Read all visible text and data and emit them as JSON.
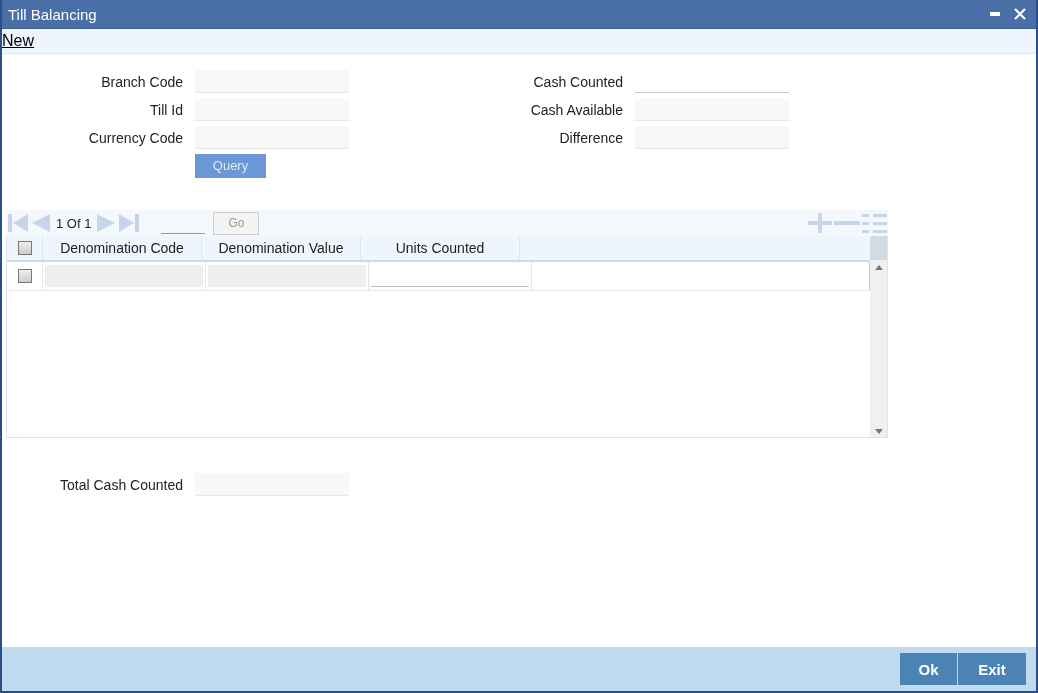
{
  "window": {
    "title": "Till Balancing"
  },
  "menu": [
    {
      "label": "New"
    }
  ],
  "left_fields": [
    {
      "label": "Branch Code",
      "editable": false
    },
    {
      "label": "Till Id",
      "editable": false
    },
    {
      "label": "Currency Code",
      "editable": false
    }
  ],
  "query_button": {
    "label": "Query",
    "disabled": true
  },
  "right_fields": [
    {
      "label": "Cash Counted",
      "editable": true
    },
    {
      "label": "Cash Available",
      "editable": false
    },
    {
      "label": "Difference",
      "editable": false
    }
  ],
  "grid": {
    "pager": {
      "text": "1 Of 1",
      "go": "Go",
      "go_disabled": true
    },
    "select_all_checked": false,
    "columns": [
      "Denomination Code",
      "Denomination Value",
      "Units Counted"
    ],
    "rows": [
      {
        "checked": false,
        "cells": [
          {
            "editable": false
          },
          {
            "editable": false
          },
          {
            "editable": true
          }
        ]
      }
    ]
  },
  "total": {
    "label": "Total Cash Counted",
    "editable": false
  },
  "buttons": [
    {
      "label": "Ok"
    },
    {
      "label": "Exit"
    }
  ]
}
